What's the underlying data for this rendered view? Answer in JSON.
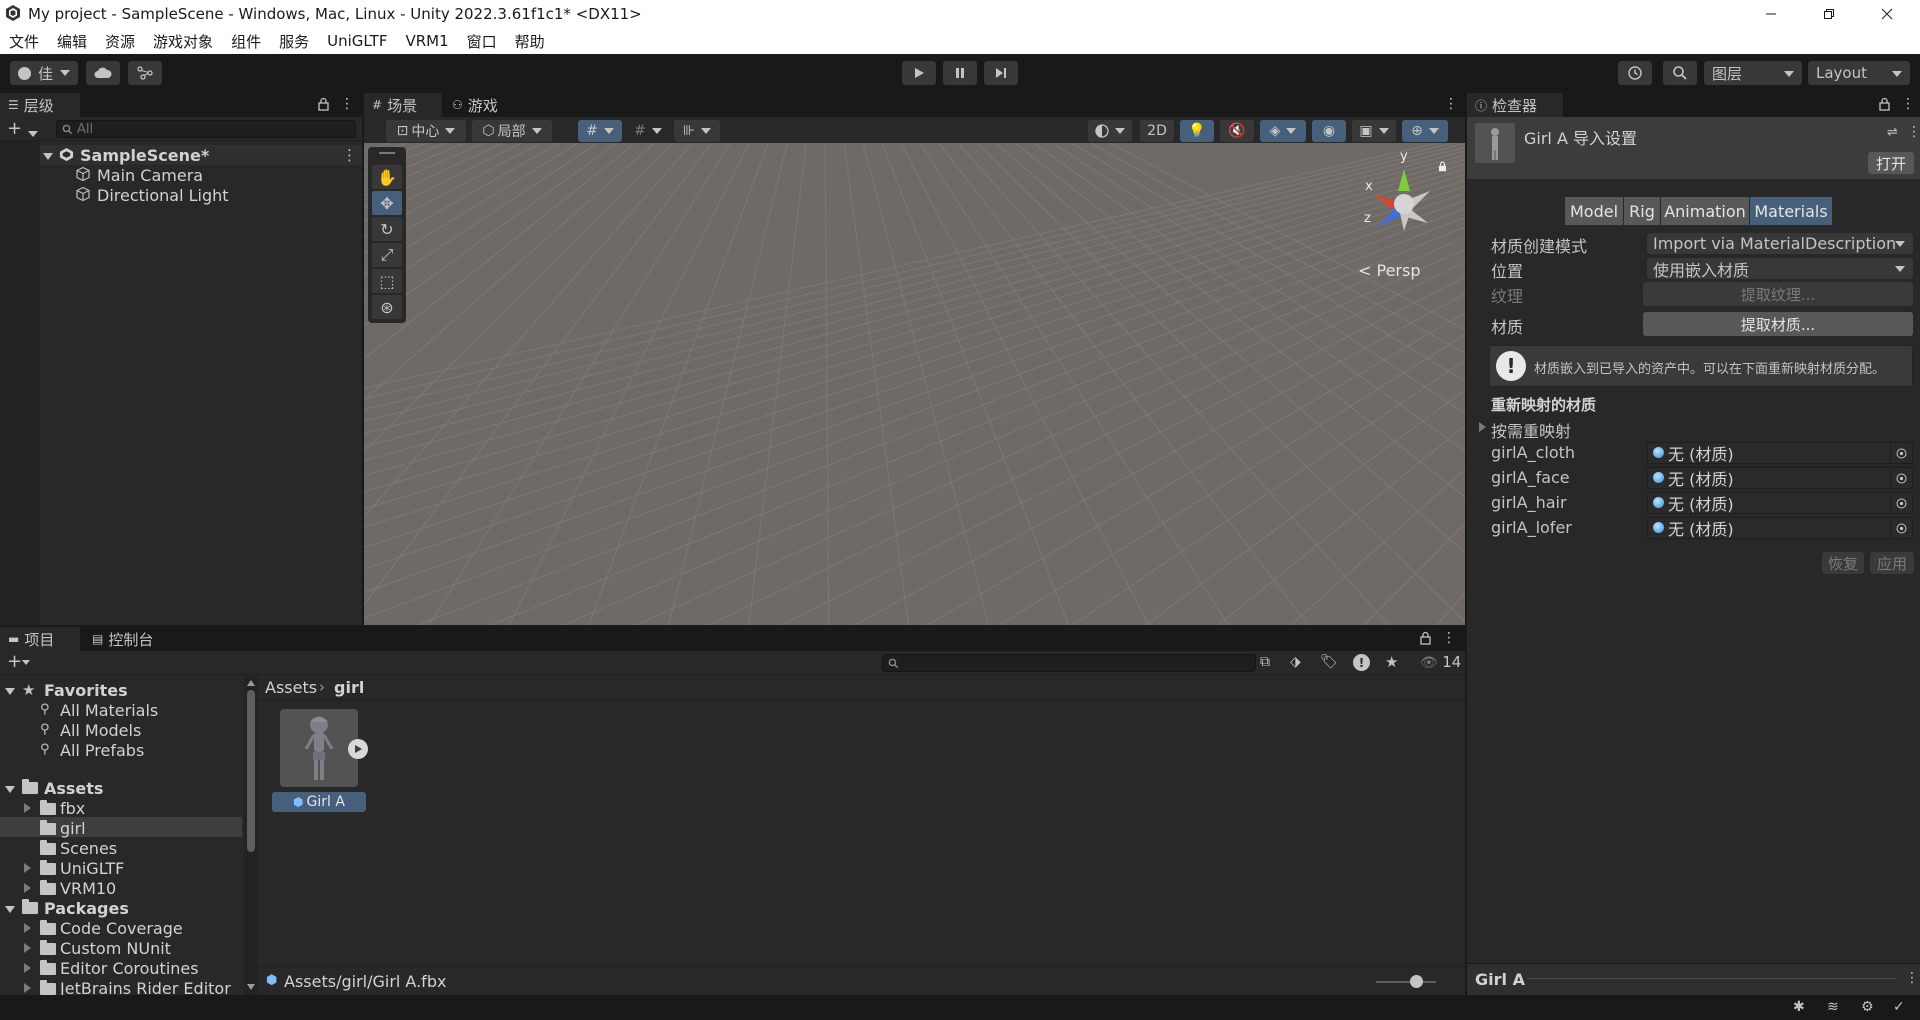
{
  "window": {
    "title": "My project - SampleScene - Windows, Mac, Linux - Unity 2022.3.61f1c1* <DX11>"
  },
  "menu": [
    "文件",
    "编辑",
    "资源",
    "游戏对象",
    "组件",
    "服务",
    "UniGLTF",
    "VRM1",
    "窗口",
    "帮助"
  ],
  "toolbar": {
    "account_label": "佳",
    "layers_label": "图层",
    "layout_label": "Layout"
  },
  "hierarchy": {
    "tab_label": "层级",
    "search_placeholder": "All",
    "scene_name": "SampleScene*",
    "items": [
      "Main Camera",
      "Directional Light"
    ]
  },
  "scene": {
    "tabs": [
      "场景",
      "游戏"
    ],
    "pivot_label": "中心",
    "space_label": "局部",
    "mode_2d": "2D",
    "gizmo": {
      "y": "y",
      "x": "x",
      "z": "z",
      "persp": "Persp"
    }
  },
  "inspector": {
    "tab_label": "检查器",
    "asset_title": "Girl A 导入设置",
    "open_button": "打开",
    "subtabs": [
      "Model",
      "Rig",
      "Animation",
      "Materials"
    ],
    "active_subtab": "Materials",
    "rows": {
      "creation_mode_label": "材质创建模式",
      "creation_mode_value": "Import via MaterialDescription",
      "location_label": "位置",
      "location_value": "使用嵌入材质",
      "textures_label": "纹理",
      "textures_button": "提取纹理...",
      "materials_label": "材质",
      "materials_button": "提取材质..."
    },
    "info_text": "材质嵌入到已导入的资产中。可以在下面重新映射材质分配。",
    "remapped_header": "重新映射的材质",
    "on_demand_label": "按需重映射",
    "materials": [
      {
        "name": "girlA_cloth",
        "value": "无 (材质)"
      },
      {
        "name": "girlA_face",
        "value": "无 (材质)"
      },
      {
        "name": "girlA_hair",
        "value": "无 (材质)"
      },
      {
        "name": "girlA_lofer",
        "value": "无 (材质)"
      }
    ],
    "revert_button": "恢复",
    "apply_button": "应用",
    "preview_title": "Girl A"
  },
  "project": {
    "tabs": [
      "项目",
      "控制台"
    ],
    "hidden_count": "14",
    "favorites": {
      "label": "Favorites",
      "items": [
        "All Materials",
        "All Models",
        "All Prefabs"
      ]
    },
    "assets": {
      "label": "Assets",
      "items": [
        "fbx",
        "girl",
        "Scenes",
        "UniGLTF",
        "VRM10"
      ]
    },
    "packages": {
      "label": "Packages",
      "items": [
        "Code Coverage",
        "Custom NUnit",
        "Editor Coroutines",
        "JetBrains Rider Editor"
      ]
    },
    "breadcrumb": [
      "Assets",
      "girl"
    ],
    "asset_tile": "Girl A",
    "selected_path": "Assets/girl/Girl A.fbx"
  },
  "colors": {
    "accent": "#46607c",
    "scene_bg": "#706a66",
    "panel_bg": "#282828"
  }
}
